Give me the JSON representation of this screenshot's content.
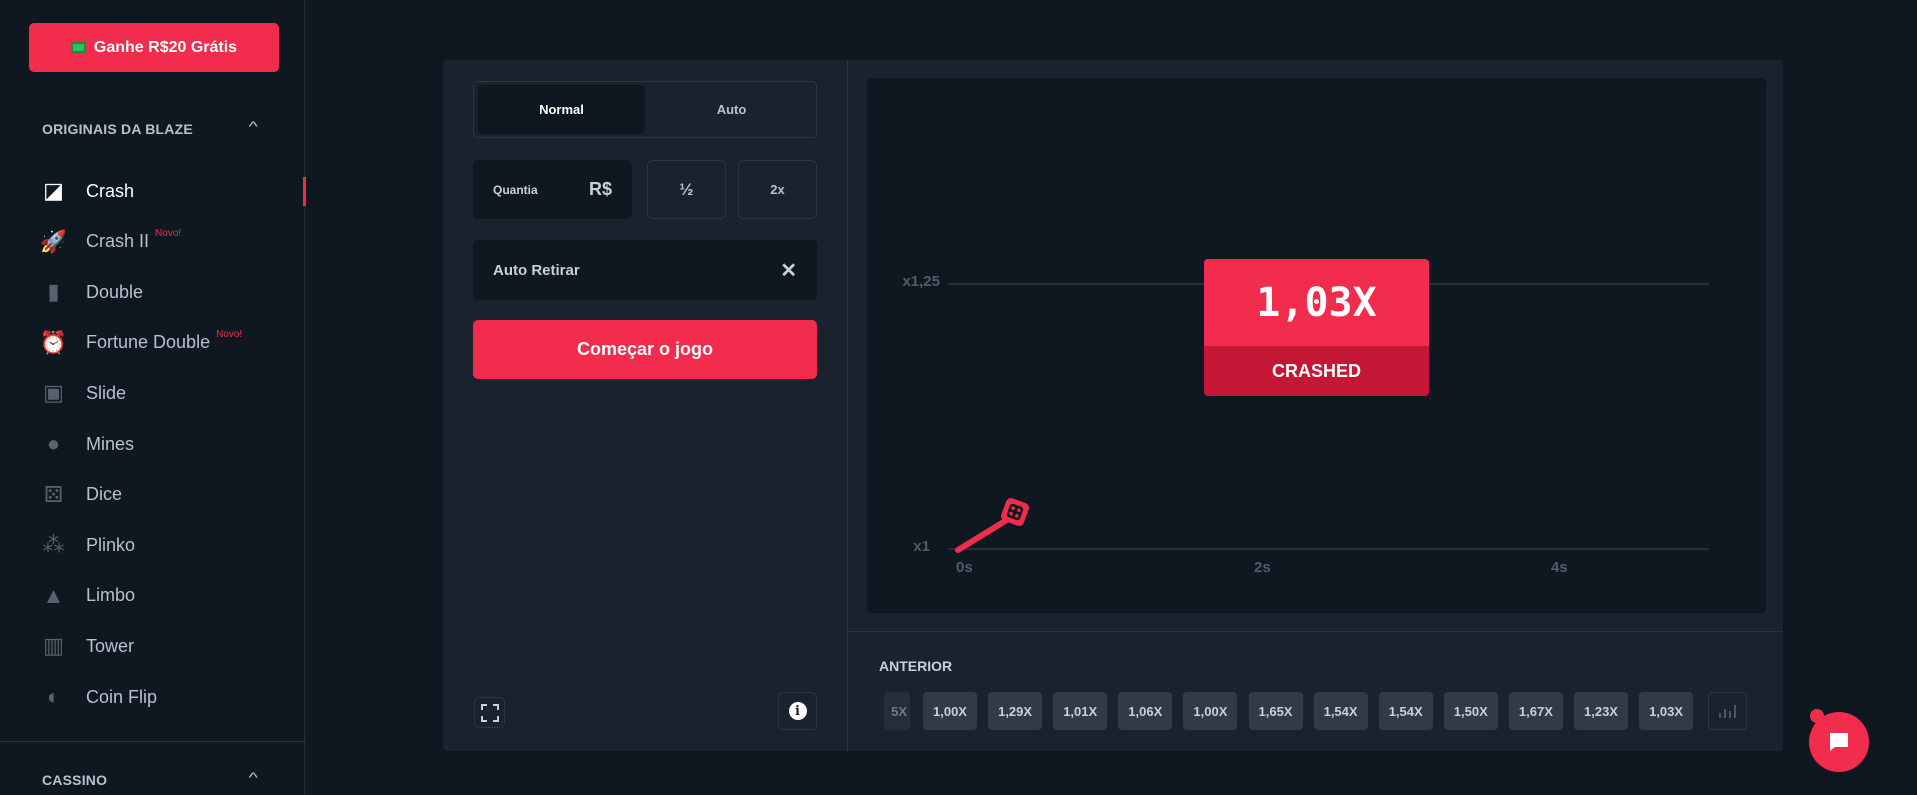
{
  "sidebar": {
    "promo_label": "Ganhe R$20 Grátis",
    "section_originals": "ORIGINAIS DA BLAZE",
    "section_casino": "CASSINO",
    "items": [
      {
        "label": "Crash",
        "icon": "crash-icon",
        "active": true
      },
      {
        "label": "Crash II",
        "icon": "rocket-icon",
        "badge": "Novo!"
      },
      {
        "label": "Double",
        "icon": "double-icon"
      },
      {
        "label": "Fortune Double",
        "icon": "fortune-clock-icon",
        "badge": "Novo!"
      },
      {
        "label": "Slide",
        "icon": "slide-icon"
      },
      {
        "label": "Mines",
        "icon": "bomb-icon"
      },
      {
        "label": "Dice",
        "icon": "dice-icon"
      },
      {
        "label": "Plinko",
        "icon": "plinko-icon"
      },
      {
        "label": "Limbo",
        "icon": "limbo-arrow-icon"
      },
      {
        "label": "Tower",
        "icon": "tower-icon"
      },
      {
        "label": "Coin Flip",
        "icon": "coin-icon"
      }
    ]
  },
  "controls": {
    "tabs": [
      "Normal",
      "Auto"
    ],
    "active_tab": "Normal",
    "amount_label": "Quantia",
    "currency": "R$",
    "half_label": "½",
    "double_label": "2x",
    "auto_cashout_label": "Auto Retirar",
    "start_label": "Começar o jogo"
  },
  "graph": {
    "y_labels": [
      "x1,25",
      "x1"
    ],
    "x_labels": [
      "0s",
      "2s",
      "4s"
    ],
    "multiplier": "1,03X",
    "status": "CRASHED"
  },
  "history": {
    "title": "ANTERIOR",
    "partial": "5X",
    "values": [
      "1,00X",
      "1,29X",
      "1,01X",
      "1,06X",
      "1,00X",
      "1,65X",
      "1,54X",
      "1,54X",
      "1,50X",
      "1,67X",
      "1,23X",
      "1,03X"
    ]
  },
  "colors": {
    "accent": "#f12c4c",
    "crashed_dark": "#c41735",
    "bg": "#0f1821",
    "panel": "#1a222d"
  }
}
